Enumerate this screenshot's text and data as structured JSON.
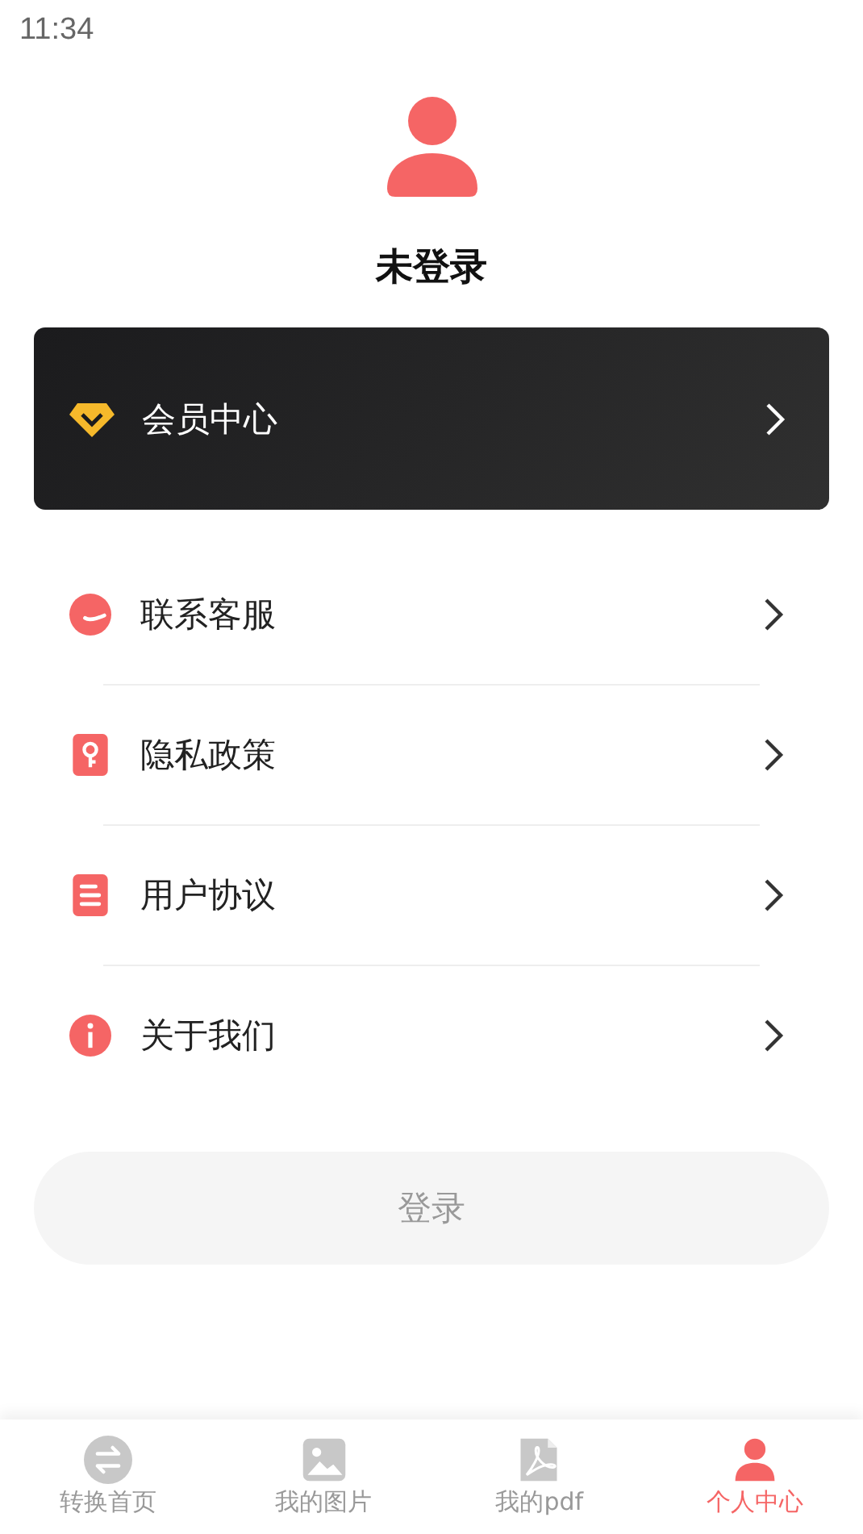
{
  "status_bar": {
    "time": "11:34"
  },
  "profile": {
    "name": "未登录"
  },
  "vip_card": {
    "label": "会员中心"
  },
  "menu": [
    {
      "kind": "service",
      "label": "联系客服"
    },
    {
      "kind": "privacy",
      "label": "隐私政策"
    },
    {
      "kind": "agreement",
      "label": "用户协议"
    },
    {
      "kind": "about",
      "label": "关于我们"
    }
  ],
  "login_button": {
    "label": "登录",
    "disabled": true
  },
  "tabs": [
    {
      "kind": "convert",
      "label": "转换首页",
      "selected": false
    },
    {
      "kind": "image",
      "label": "我的图片",
      "selected": false
    },
    {
      "kind": "pdf",
      "label": "我的pdf",
      "selected": false
    },
    {
      "kind": "person",
      "label": "个人中心",
      "selected": true
    }
  ]
}
